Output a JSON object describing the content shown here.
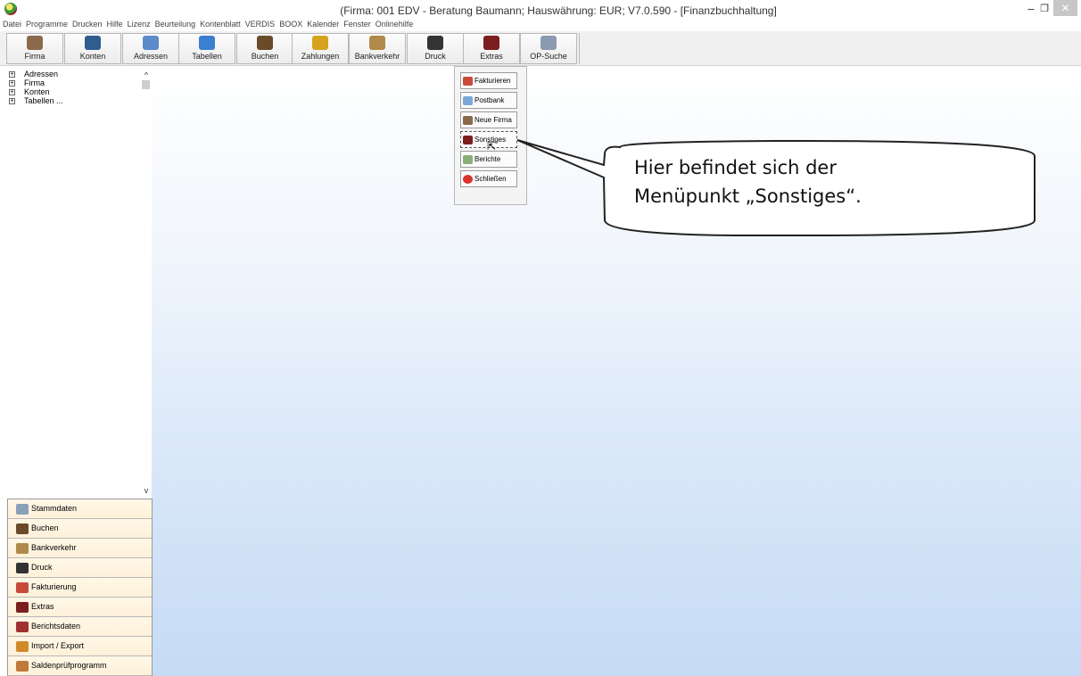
{
  "window": {
    "title": "(Firma: 001 EDV - Beratung Baumann;  Hauswährung: EUR; V7.0.590 - [Finanzbuchhaltung]",
    "minimize": "–",
    "restore": "❐",
    "close": "✕"
  },
  "menu": [
    "Datei",
    "Programme",
    "Drucken",
    "Hilfe",
    "Lizenz",
    "Beurteilung",
    "Kontenblatt",
    "VERDIS",
    "BOOX",
    "Kalender",
    "Fenster",
    "Onlinehilfe"
  ],
  "toolbar": [
    {
      "label": "Firma",
      "icon": "firma-icon",
      "color": "#8a6a4a"
    },
    {
      "label": "Konten",
      "icon": "konten-icon",
      "color": "#2f5d8f"
    },
    {
      "label": "Adressen",
      "icon": "adressen-icon",
      "color": "#5b8cc9"
    },
    {
      "label": "Tabellen",
      "icon": "tabellen-icon",
      "color": "#3b7fd0"
    },
    {
      "label": "Buchen",
      "icon": "buchen-icon",
      "color": "#6b4a2a"
    },
    {
      "label": "Zahlungen",
      "icon": "zahlungen-icon",
      "color": "#d6a21e"
    },
    {
      "label": "Bankverkehr",
      "icon": "bankverkehr-icon",
      "color": "#b08a4a"
    },
    {
      "label": "Druck",
      "icon": "druck-icon",
      "color": "#333333"
    },
    {
      "label": "Extras",
      "icon": "extras-icon",
      "color": "#7a1e1e"
    },
    {
      "label": "OP-Suche",
      "icon": "op-suche-icon",
      "color": "#8a9ab0"
    }
  ],
  "tree": [
    {
      "label": "Adressen",
      "expander": "+"
    },
    {
      "label": "Firma",
      "expander": "+"
    },
    {
      "label": "Konten",
      "expander": "+"
    },
    {
      "label": "Tabellen ...",
      "expander": "+"
    }
  ],
  "scrollbar": {
    "up": "^",
    "down": "v"
  },
  "nav": [
    {
      "label": "Stammdaten",
      "icon": "stammdaten-icon",
      "color": "#8aa0b8"
    },
    {
      "label": "Buchen",
      "icon": "buchen-icon",
      "color": "#6b4a2a"
    },
    {
      "label": "Bankverkehr",
      "icon": "bankverkehr-icon",
      "color": "#b08a4a"
    },
    {
      "label": "Druck",
      "icon": "druck-icon",
      "color": "#333333"
    },
    {
      "label": "Fakturierung",
      "icon": "fakturierung-icon",
      "color": "#c84a3a"
    },
    {
      "label": "Extras",
      "icon": "extras-icon",
      "color": "#7a1e1e"
    },
    {
      "label": "Berichtsdaten",
      "icon": "berichtsdaten-icon",
      "color": "#a03030"
    },
    {
      "label": "Import / Export",
      "icon": "import-export-icon",
      "color": "#d08a2a"
    },
    {
      "label": "Saldenprüfprogramm",
      "icon": "saldenpruef-icon",
      "color": "#c07a3a"
    }
  ],
  "extras_menu": [
    {
      "label": "Fakturieren",
      "icon": "fakturieren-icon",
      "color": "#c84a3a"
    },
    {
      "label": "Postbank",
      "icon": "postbank-icon",
      "color": "#7aa8d8"
    },
    {
      "label": "Neue Firma",
      "icon": "neue-firma-icon",
      "color": "#8a6a4a"
    },
    {
      "label": "Sonstiges",
      "icon": "sonstiges-icon",
      "color": "#7a1e1e"
    },
    {
      "label": "Berichte",
      "icon": "berichte-icon",
      "color": "#8ab07a"
    },
    {
      "label": "Schließen",
      "icon": "close-icon",
      "color": "#d9342b"
    }
  ],
  "callout": {
    "line1": "Hier befindet sich der",
    "line2": "Menüpunkt „Sonstiges“."
  }
}
